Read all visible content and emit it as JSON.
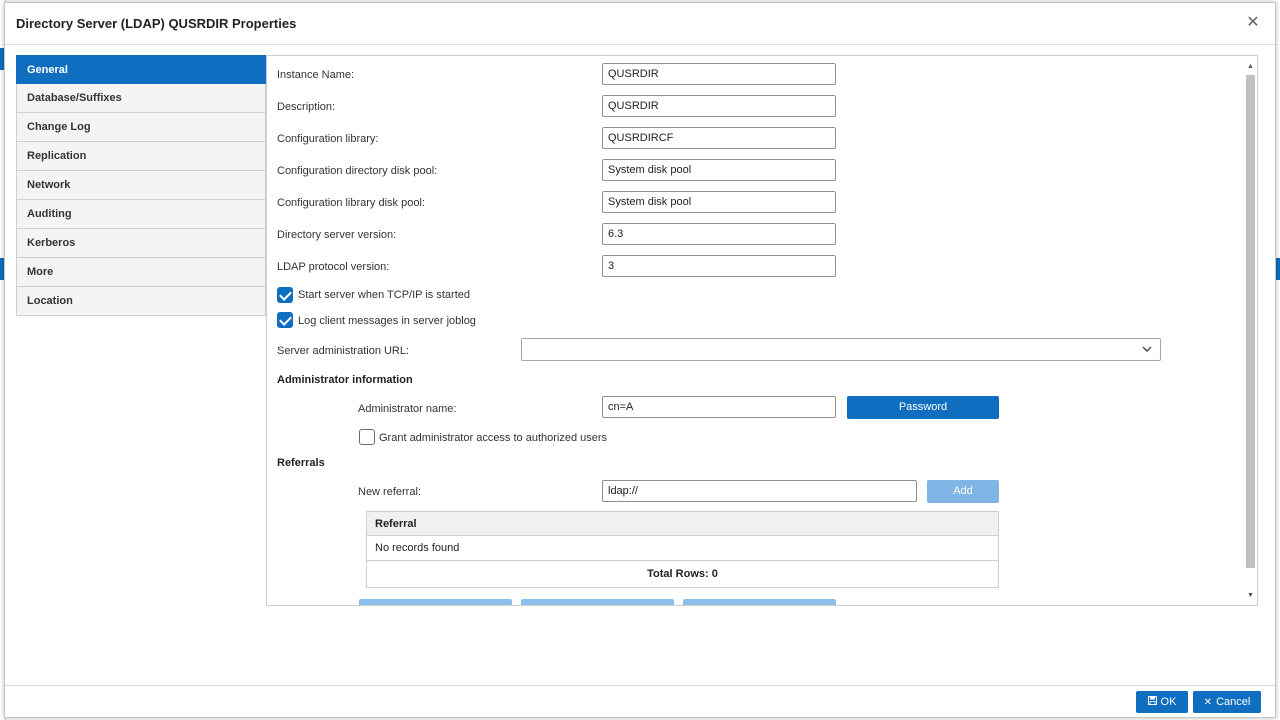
{
  "dialog": {
    "title": "Directory Server (LDAP) QUSRDIR Properties",
    "close_glyph": "✕"
  },
  "nav": {
    "items": [
      {
        "label": "General",
        "active": true
      },
      {
        "label": "Database/Suffixes"
      },
      {
        "label": "Change Log"
      },
      {
        "label": "Replication"
      },
      {
        "label": "Network"
      },
      {
        "label": "Auditing"
      },
      {
        "label": "Kerberos"
      },
      {
        "label": "More"
      },
      {
        "label": "Location"
      }
    ]
  },
  "general": {
    "instance_name": {
      "label": "Instance Name:",
      "value": "QUSRDIR"
    },
    "description": {
      "label": "Description:",
      "value": "QUSRDIR"
    },
    "config_library": {
      "label": "Configuration library:",
      "value": "QUSRDIRCF"
    },
    "config_dir_disk_pool": {
      "label": "Configuration directory disk pool:",
      "value": "System disk pool"
    },
    "config_lib_disk_pool": {
      "label": "Configuration library disk pool:",
      "value": "System disk pool"
    },
    "server_version": {
      "label": "Directory server version:",
      "value": "6.3"
    },
    "ldap_protocol_version": {
      "label": "LDAP protocol version:",
      "value": "3"
    },
    "start_server_checkbox": {
      "label": "Start server when TCP/IP is started",
      "checked": true
    },
    "log_client_checkbox": {
      "label": "Log client messages in server joblog",
      "checked": true
    },
    "server_admin_url": {
      "label": "Server administration URL:",
      "value": ""
    }
  },
  "admin": {
    "section_title": "Administrator information",
    "name_label": "Administrator name:",
    "name_value": "cn=A",
    "password_button": "Password",
    "grant_checkbox": {
      "label": "Grant administrator access to authorized users",
      "checked": false
    }
  },
  "referrals": {
    "section_title": "Referrals",
    "new_referral_label": "New referral:",
    "new_referral_value": "ldap://",
    "add_button": "Add",
    "table": {
      "column": "Referral",
      "empty_text": "No records found",
      "total_rows": "Total Rows: 0"
    }
  },
  "footer": {
    "ok_label": "OK",
    "cancel_label": "Cancel"
  },
  "colors": {
    "accent": "#0f6ebf",
    "disabled_accent": "#7fb6e6"
  }
}
